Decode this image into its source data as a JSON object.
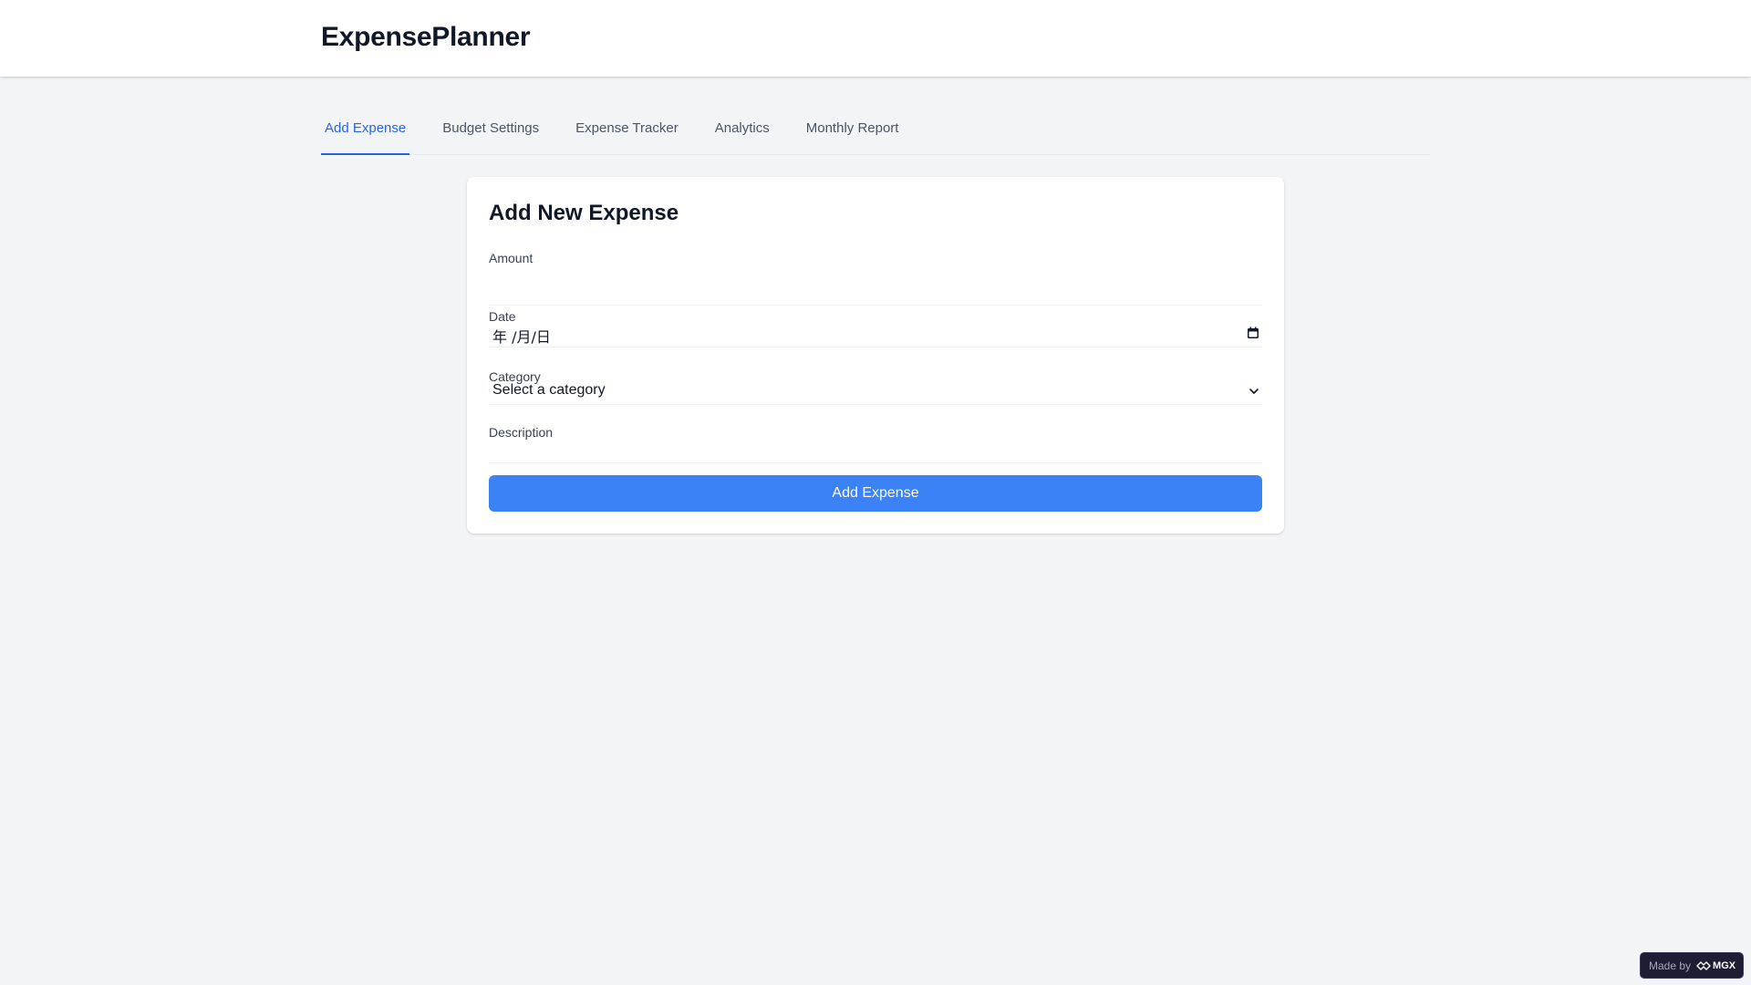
{
  "header": {
    "title": "ExpensePlanner"
  },
  "tabs": [
    {
      "label": "Add Expense",
      "active": true
    },
    {
      "label": "Budget Settings",
      "active": false
    },
    {
      "label": "Expense Tracker",
      "active": false
    },
    {
      "label": "Analytics",
      "active": false
    },
    {
      "label": "Monthly Report",
      "active": false
    }
  ],
  "form": {
    "title": "Add New Expense",
    "amount": {
      "label": "Amount",
      "value": ""
    },
    "date": {
      "label": "Date",
      "value": "年 /月/日",
      "icon": "calendar-icon"
    },
    "category": {
      "label": "Category",
      "selected": "Select a category",
      "icon": "chevron-down-icon"
    },
    "description": {
      "label": "Description",
      "value": ""
    },
    "submit_label": "Add Expense"
  },
  "badge": {
    "prefix": "Made by",
    "brand": "MGX"
  },
  "colors": {
    "accent": "#3b82f6",
    "active_tab": "#2563eb",
    "background": "#f3f4f6"
  }
}
